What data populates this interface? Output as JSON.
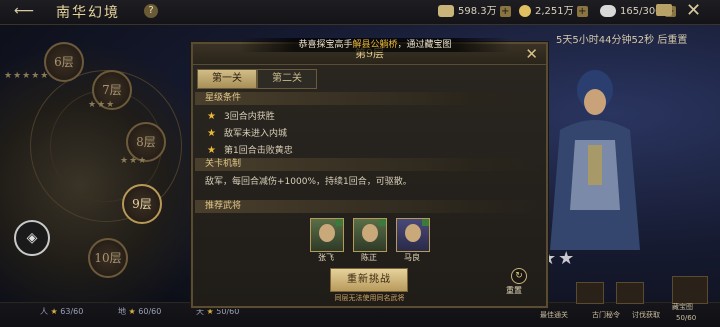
{
  "header": {
    "back_icon": "back-arrow-icon",
    "title": "南华幻境",
    "help": "?"
  },
  "resources": [
    {
      "name": "silver",
      "value": "598.3万",
      "color": "#c9b47a"
    },
    {
      "name": "gold",
      "value": "2,251万",
      "color": "#e0c060"
    },
    {
      "name": "stamina",
      "value": "165/300",
      "color": "#d8d8d8"
    }
  ],
  "timer": "5天5小时44分钟52秒 后重置",
  "floors": [
    {
      "label": "6层"
    },
    {
      "label": "7层"
    },
    {
      "label": "8层"
    },
    {
      "label": "9层"
    },
    {
      "label": "10层"
    }
  ],
  "bottom_stats": [
    {
      "prefix": "人",
      "value": "63/60"
    },
    {
      "prefix": "地",
      "value": "60/60"
    },
    {
      "prefix": "天",
      "value": "50/60"
    }
  ],
  "toast": {
    "pre": "恭喜探宝高手",
    "name": "解县公躺桥",
    "post": "，通过藏宝图"
  },
  "modal": {
    "title": "第9层",
    "tabs": [
      "第一关",
      "第二关"
    ],
    "star_section": "星级条件",
    "conditions": [
      "3回合内获胜",
      "敌军未进入内城",
      "第1回合击败黄忠"
    ],
    "mechanism_section": "关卡机制",
    "mechanism": "敌军，每回合减伤+1000%，持续1回合，可驱散。",
    "generals_section": "推荐武将",
    "generals": [
      "张飞",
      "陈正",
      "马良"
    ],
    "retry_button": "重新挑战",
    "note": "同层无法使用同名武将",
    "reset_label": "重置"
  },
  "side_buttons": [
    {
      "label": "藏宝图"
    }
  ],
  "side_labels": [
    "最佳通关",
    "古门秘令",
    "讨伐获取"
  ],
  "corner_stat": "50/60"
}
